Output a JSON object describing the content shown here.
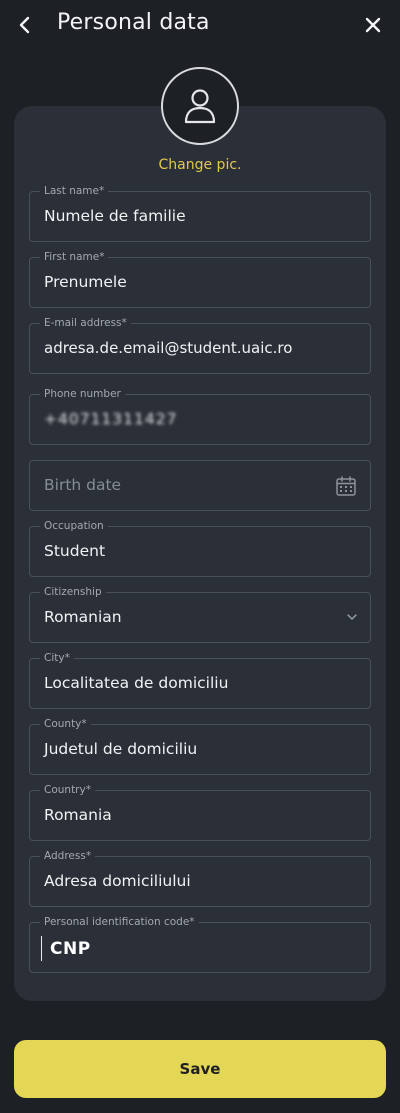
{
  "header": {
    "title": "Personal data",
    "back_icon": "chevron-left-icon",
    "close_icon": "close-icon"
  },
  "profile": {
    "avatar_icon": "user-icon",
    "change_pic_label": "Change pic."
  },
  "fields": {
    "last_name": {
      "label": "Last name*",
      "value": "Numele de familie"
    },
    "first_name": {
      "label": "First name*",
      "value": "Prenumele"
    },
    "email": {
      "label": "E-mail address*",
      "value": "adresa.de.email@student.uaic.ro"
    },
    "phone": {
      "label": "Phone number",
      "value": "+40711311427"
    },
    "birth_date": {
      "placeholder": "Birth date",
      "icon": "calendar-icon"
    },
    "occupation": {
      "label": "Occupation",
      "value": "Student"
    },
    "citizenship": {
      "label": "Citizenship",
      "value": "Romanian",
      "icon": "chevron-down-icon"
    },
    "city": {
      "label": "City*",
      "value": "Localitatea de domiciliu"
    },
    "county": {
      "label": "County*",
      "value": "Judetul de domiciliu"
    },
    "country": {
      "label": "Country*",
      "value": "Romania"
    },
    "address": {
      "label": "Address*",
      "value": "Adresa domiciliului"
    },
    "cnp": {
      "label": "Personal identification code*",
      "value": "CNP"
    }
  },
  "actions": {
    "save_label": "Save"
  },
  "colors": {
    "background": "#1d2126",
    "card": "#2b3038",
    "accent": "#e3d755",
    "change_pic": "#e2c84a"
  }
}
